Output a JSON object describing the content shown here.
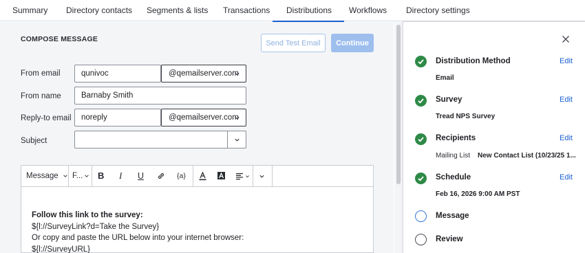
{
  "nav": {
    "tabs": [
      {
        "label": "Summary"
      },
      {
        "label": "Directory contacts"
      },
      {
        "label": "Segments & lists"
      },
      {
        "label": "Transactions"
      },
      {
        "label": "Distributions"
      },
      {
        "label": "Workflows"
      },
      {
        "label": "Directory settings"
      }
    ],
    "active_tab": "Distributions"
  },
  "compose": {
    "title": "COMPOSE MESSAGE",
    "send_test_label": "Send Test Email",
    "continue_label": "Continue",
    "from_email": {
      "label": "From email",
      "value": "qunivoc",
      "domain": "@qemailserver.com"
    },
    "from_name": {
      "label": "From name",
      "value": "Barnaby Smith"
    },
    "reply_to": {
      "label": "Reply-to email",
      "value": "noreply",
      "domain": "@qemailserver.com"
    },
    "subject": {
      "label": "Subject",
      "value": ""
    }
  },
  "editor": {
    "toolbar": {
      "message_select": "Message",
      "font_select": "F...",
      "bold": "B",
      "italic": "I",
      "underline": "U",
      "piped_text": "{a}"
    },
    "body": {
      "line1": "Follow this link to the survey:",
      "line2": "${l://SurveyLink?d=Take the Survey}",
      "line3": "Or copy and paste the URL below into your internet browser:",
      "line4": "${l://SurveyURL}"
    }
  },
  "panel": {
    "steps": [
      {
        "title": "Distribution Method",
        "value": "Email",
        "edit": "Edit",
        "status": "done"
      },
      {
        "title": "Survey",
        "value": "Tread NPS Survey",
        "edit": "Edit",
        "status": "done"
      },
      {
        "title": "Recipients",
        "sub_label": "Mailing List",
        "value": "New Contact List (10/23/25 1...",
        "edit": "Edit",
        "status": "done"
      },
      {
        "title": "Schedule",
        "value": "Feb 16, 2026 9:00 AM PST",
        "edit": "Edit",
        "status": "done"
      },
      {
        "title": "Message",
        "status": "current"
      },
      {
        "title": "Review",
        "status": "pending"
      }
    ]
  },
  "colors": {
    "accent": "#1a5fd1",
    "success": "#2e8a47",
    "button_disabled": "#9ebfee"
  }
}
